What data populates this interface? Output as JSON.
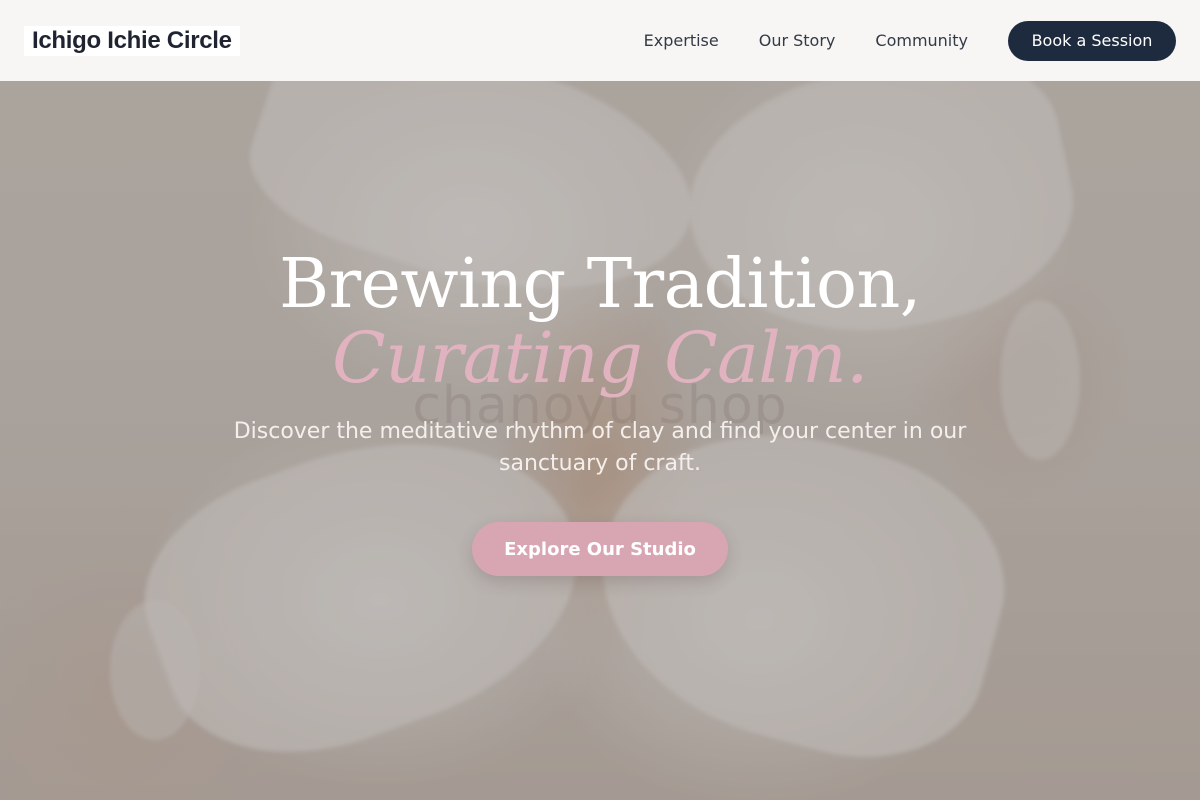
{
  "header": {
    "logo": "Ichigo Ichie Circle",
    "nav": [
      {
        "label": "Expertise"
      },
      {
        "label": "Our Story"
      },
      {
        "label": "Community"
      }
    ],
    "book_button": "Book a Session"
  },
  "hero": {
    "headline": "Brewing Tradition,",
    "headline_accent": "Curating Calm.",
    "watermark": "chanoyu shop",
    "subtitle": "Discover the meditative rhythm of clay and find your center in our sanctuary of craft.",
    "cta": "Explore Our Studio",
    "background_image": "ceramic-cups-photo"
  },
  "colors": {
    "header_bg": "#faf9f8",
    "primary_dark": "#1e2a3e",
    "accent_pink": "#e1b3c0",
    "cta_pink": "#d8a6b3",
    "text_light": "#ffffff"
  }
}
